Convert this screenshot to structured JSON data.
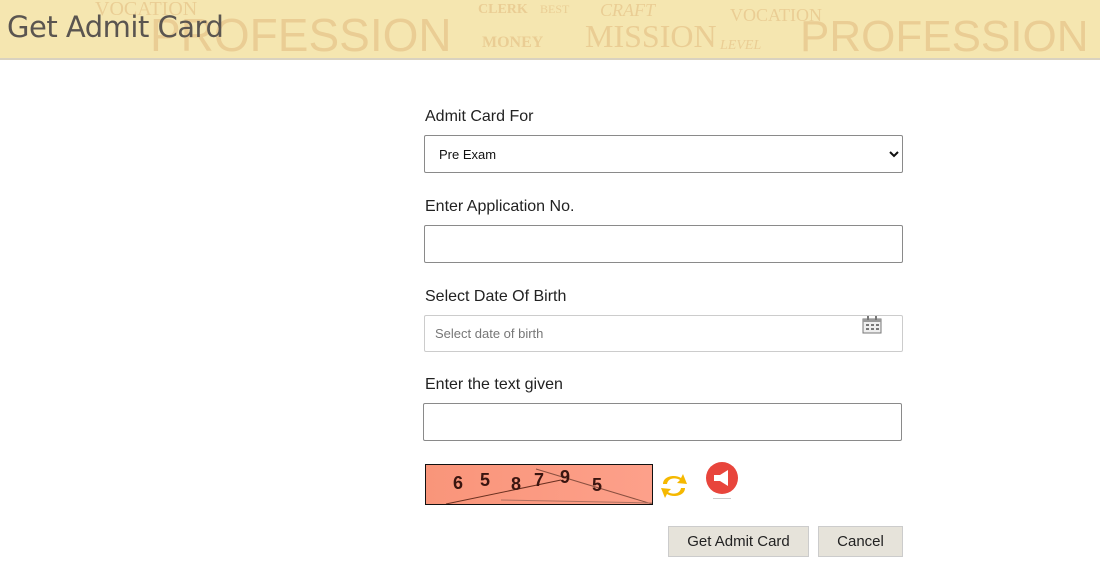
{
  "header": {
    "title": "Get Admit Card",
    "background_words": [
      "VOCATION",
      "PROFESSION",
      "CLERK",
      "BEST",
      "MONEY",
      "MISSION",
      "CRAFT",
      "VOCATION",
      "LEVEL",
      "PROFESSION"
    ]
  },
  "form": {
    "admit_card_for": {
      "label": "Admit Card For",
      "value": "Pre Exam"
    },
    "application_no": {
      "label": "Enter Application No.",
      "value": ""
    },
    "dob": {
      "label": "Select Date Of Birth",
      "placeholder": "Select date of birth",
      "icon": "calendar-icon"
    },
    "captcha_text": {
      "label": "Enter the text given",
      "value": ""
    },
    "captcha": {
      "digits": [
        "6",
        "5",
        "8",
        "7",
        "9",
        "5"
      ],
      "background": "#f9957a",
      "refresh_icon": "refresh-icon",
      "audio_icon": "audio-icon"
    }
  },
  "buttons": {
    "submit": "Get Admit Card",
    "cancel": "Cancel"
  }
}
